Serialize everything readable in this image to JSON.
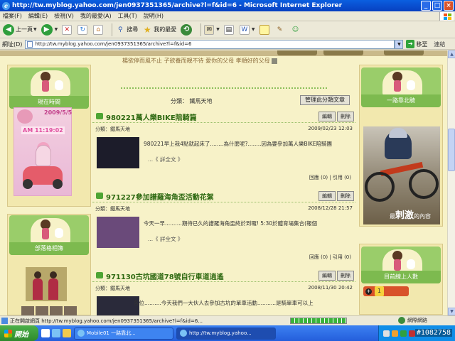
{
  "window": {
    "title": "http://tw.myblog.yahoo.com/jen0937351365/archive?l=f&id=6 - Microsoft Internet Explorer",
    "min": "_",
    "max": "□",
    "close": "×"
  },
  "menu": [
    "檔案(F)",
    "編輯(E)",
    "檢視(V)",
    "我的最愛(A)",
    "工具(T)",
    "說明(H)"
  ],
  "toolbar": {
    "back": "上一頁",
    "search": "搜尋",
    "favorites": "我的最愛"
  },
  "address": {
    "label": "網址(D)",
    "url": "http://tw.myblog.yahoo.com/jen0937351365/archive?l=f&id=6",
    "go": "移至",
    "links": "連結"
  },
  "page": {
    "slogan": "楊欲停而風不止 子欲養而親不待 愛你的父母 孝順好的父母",
    "left": {
      "time_title": "現在時間",
      "clock_date": "2009/5/5",
      "clock_time": "AM 11:19:02",
      "friends_title": "部落格相簿"
    },
    "category_label": "分類： 鐵馬天地",
    "manage_button": "管理此分類文章",
    "posts": [
      {
        "title": "980221萬人樂BIKE陪騎篇",
        "edit": "編輯",
        "delete": "刪除",
        "category": "分類：鐵馬天地",
        "date": "2009/02/23 12:03",
        "excerpt": "980221早上我4點就起床了........為什麼呢?........因為要參加萬人樂BIKE陪騎團",
        "more": "...《 詳全文 》",
        "stats": "回應 (0) | 引用 (0)"
      },
      {
        "title": "971227參加譜羅海角盃活動花絮",
        "edit": "編輯",
        "delete": "刪除",
        "category": "分類：鐵馬天地",
        "date": "2008/12/28 21:57",
        "excerpt": "今天一早..........期待已久的譜羅海角盃終於到囉! 5:30於體育場集合(報個",
        "more": "...《 詳全文 》",
        "stats": "回應 (0) | 引用 (0)"
      },
      {
        "title": "971130古坑國道78號自行車道逍遙",
        "edit": "編輯",
        "delete": "刪除",
        "category": "分類：鐵馬天地",
        "date": "2008/11/30 20:42",
        "excerpt": "各位..........今天我們一大伙人去參加古坑的單車活動...........是騎單車可以上",
        "more": "",
        "stats": ""
      }
    ],
    "right": {
      "top_title": "一路靠北騎",
      "bike_caption_small": "最",
      "bike_caption_big": "刺激",
      "bike_caption_tail": "的內容",
      "online_title": "目前線上人數",
      "online_count": "1"
    }
  },
  "status": {
    "text": "正在開啟網頁 http://tw.myblog.yahoo.com/jen0937351365/archive?l=f&id=6...",
    "zone": "網際網路",
    "progress": 1.0
  },
  "taskbar": {
    "start": "開始",
    "tasks": [
      "Mobile01 一路靠北...",
      "http://tw.myblog.yahoo..."
    ],
    "watermark": "#1082758"
  },
  "colors": {
    "page_bg": "#F7F2C8",
    "post_title": "#2F6A12",
    "side_green": "#7DBA4F"
  }
}
